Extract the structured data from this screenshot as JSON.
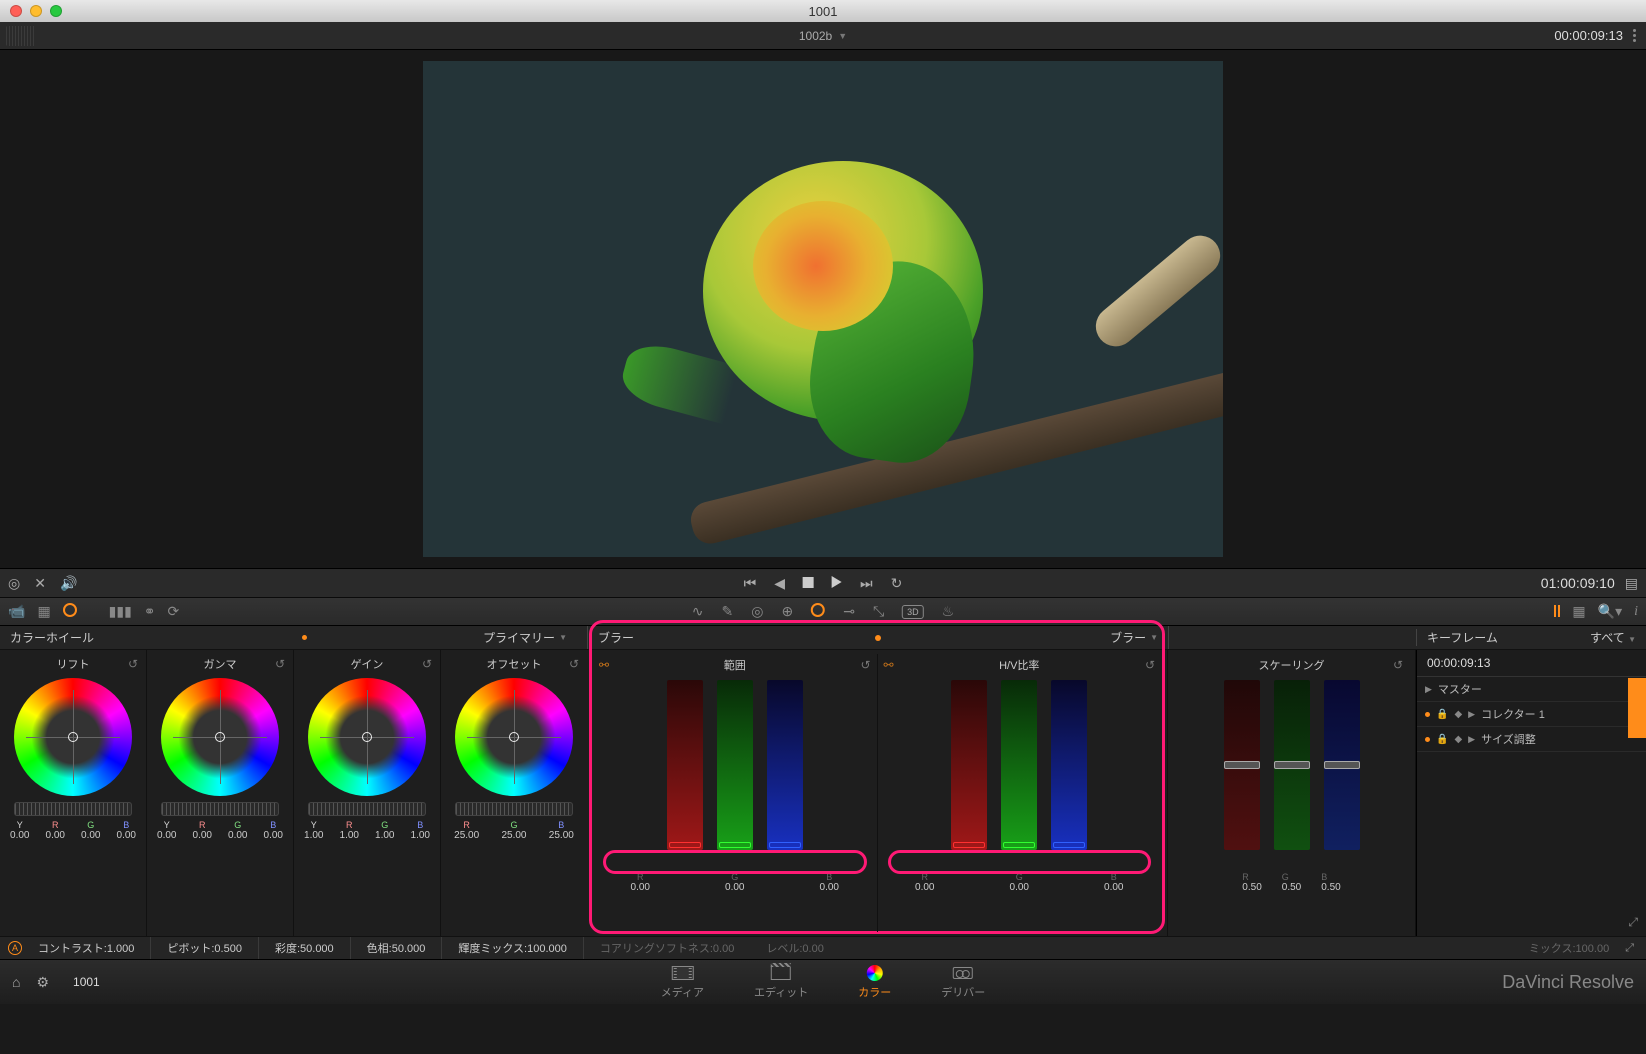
{
  "os": {
    "title": "1001"
  },
  "topbar": {
    "clip_name": "1002b",
    "timecode": "00:00:09:13"
  },
  "transport": {
    "timecode": "01:00:09:10"
  },
  "panel_headers": {
    "wheels_title": "カラーホイール",
    "primary_label": "プライマリー",
    "blur_title": "ブラー",
    "blur_dd": "ブラー",
    "keyframe_title": "キーフレーム",
    "keyframe_all": "すべて"
  },
  "wheels": [
    {
      "name": "リフト",
      "labels": [
        "Y",
        "R",
        "G",
        "B"
      ],
      "values": [
        "0.00",
        "0.00",
        "0.00",
        "0.00"
      ]
    },
    {
      "name": "ガンマ",
      "labels": [
        "Y",
        "R",
        "G",
        "B"
      ],
      "values": [
        "0.00",
        "0.00",
        "0.00",
        "0.00"
      ]
    },
    {
      "name": "ゲイン",
      "labels": [
        "Y",
        "R",
        "G",
        "B"
      ],
      "values": [
        "1.00",
        "1.00",
        "1.00",
        "1.00"
      ]
    },
    {
      "name": "オフセット",
      "labels": [
        "R",
        "G",
        "B"
      ],
      "values": [
        "25.00",
        "25.00",
        "25.00"
      ]
    }
  ],
  "blur": {
    "cols": [
      {
        "title": "範囲",
        "labels": [
          "R",
          "G",
          "B"
        ],
        "values": [
          "0.00",
          "0.00",
          "0.00"
        ]
      },
      {
        "title": "H/V比率",
        "labels": [
          "R",
          "G",
          "B"
        ],
        "values": [
          "0.00",
          "0.00",
          "0.00"
        ]
      }
    ],
    "coring_label": "コアリングソフトネス:0.00",
    "level_label": "レベル:0.00"
  },
  "scaling": {
    "title": "スケーリング",
    "labels": [
      "R",
      "G",
      "B"
    ],
    "values": [
      "0.50",
      "0.50",
      "0.50"
    ],
    "mix_label": "ミックス:100.00"
  },
  "keyframes": {
    "timecode": "00:00:09:13",
    "rows": [
      "マスター",
      "コレクター 1",
      "サイズ調整"
    ]
  },
  "status": {
    "contrast": "コントラスト:1.000",
    "pivot": "ピボット:0.500",
    "sat": "彩度:50.000",
    "hue": "色相:50.000",
    "lummix": "輝度ミックス:100.000"
  },
  "pages": {
    "media": "メディア",
    "edit": "エディット",
    "color": "カラー",
    "deliver": "デリバー",
    "project": "1001",
    "brand": "DaVinci Resolve"
  }
}
